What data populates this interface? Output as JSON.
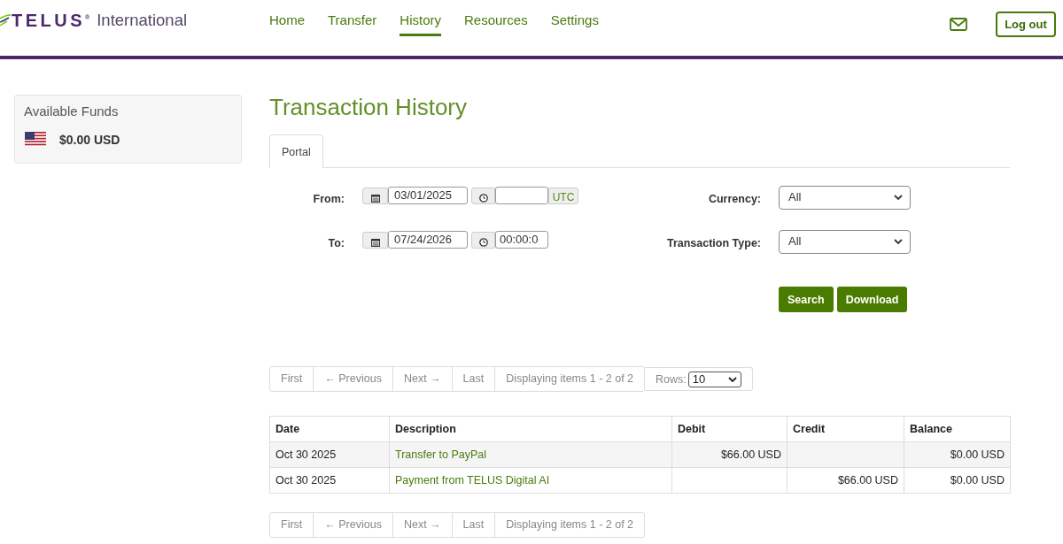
{
  "logo": {
    "brand": "TELUS$^{®}$",
    "suffix": "International"
  },
  "nav": [
    {
      "label": "Home",
      "selected": false
    },
    {
      "label": "Transfer",
      "selected": false
    },
    {
      "label": "History",
      "selected": true
    },
    {
      "label": "Resources",
      "selected": false
    },
    {
      "label": "Settings",
      "selected": false
    }
  ],
  "logout": "Log out",
  "funds": {
    "title": "Available Funds",
    "amount": "$0.00 USD"
  },
  "page_title": "Transaction History",
  "tabs": [
    {
      "label": "Portal",
      "selected": true
    }
  ],
  "filters": {
    "from": {
      "label": "From:",
      "date": "03/01/2025",
      "zone": "UTC"
    },
    "to": {
      "label": "To:",
      "date": "07/24/2026",
      "time": "00:00:0"
    },
    "currency": {
      "label": "Currency:",
      "value": "All"
    },
    "transaction_type": {
      "label": "Transaction Type:",
      "value": "All"
    }
  },
  "buttons": [
    "Search",
    "Download"
  ],
  "pager_top": {
    "links": [
      {
        "label": "First",
        "disabled": true
      },
      {
        "label": "← Previous",
        "disabled": true
      },
      {
        "label": "Next →",
        "disabled": true
      },
      {
        "label": "Last",
        "disabled": true
      }
    ],
    "summary": "Displaying items 1 - 2 of 2",
    "rows": {
      "label": "Rows:",
      "value": "10"
    }
  },
  "table": {
    "columns": [
      {
        "label": "Date",
        "kind": "text"
      },
      {
        "label": "Description",
        "kind": "link"
      },
      {
        "label": "Debit",
        "kind": "amount"
      },
      {
        "label": "Credit",
        "kind": "amount"
      },
      {
        "label": "Balance",
        "kind": "amount"
      }
    ],
    "rows": [
      {
        "date": "Oct 30 2025",
        "description": "Transfer to PayPal",
        "debit": "$66.00 USD",
        "balance": "$0.00 USD"
      },
      {
        "date": "Oct 30 2025",
        "description": "Payment from TELUS Digital AI",
        "credit": "$66.00 USD",
        "balance": "$0.00 USD"
      }
    ]
  },
  "pager_bottom": {
    "links": [
      {
        "label": "First",
        "disabled": true
      },
      {
        "label": "← Previous",
        "disabled": true
      },
      {
        "label": "Next →",
        "disabled": true
      },
      {
        "label": "Last",
        "disabled": true
      }
    ],
    "summary": "Displaying items 1 - 2 of 2"
  }
}
